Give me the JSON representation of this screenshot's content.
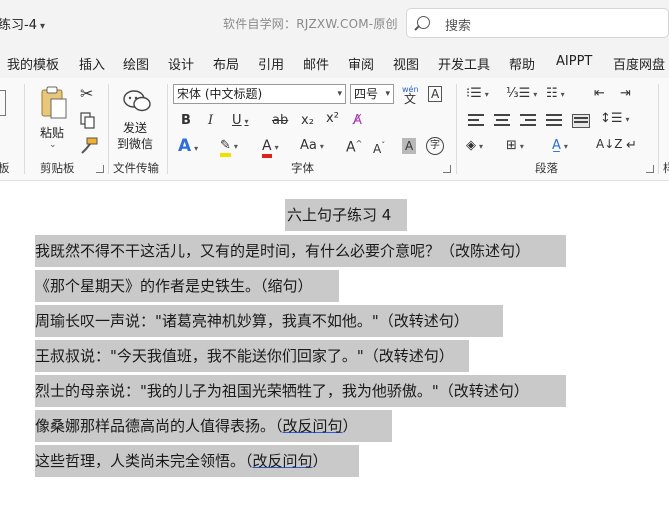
{
  "window": {
    "doc_title": "练习-4",
    "watermark": "软件自学网：RJZXW.COM-原创",
    "search_placeholder": "搜索"
  },
  "menu": [
    "我的模板",
    "插入",
    "绘图",
    "设计",
    "布局",
    "引用",
    "邮件",
    "审阅",
    "视图",
    "开发工具",
    "帮助",
    "AIPPT",
    "百度网盘"
  ],
  "ribbon": {
    "clipboard": {
      "paste_label": "粘贴",
      "group_label": "剪贴板"
    },
    "wechat": {
      "line1": "发送",
      "line2": "到微信",
      "group_label": "文件传输"
    },
    "font": {
      "name": "宋体 (中文标题)",
      "size": "四号",
      "phonetic": "wén",
      "group_label": "字体",
      "bold": "B",
      "italic": "I",
      "underline": "U",
      "strike": "ab",
      "sub": "x₂",
      "sup": "x²",
      "effects": "A",
      "highlight": "ab",
      "color": "A",
      "case": "Aa",
      "grow": "A",
      "shrink": "A",
      "shade": "A",
      "circle": "字"
    },
    "paragraph": {
      "group_label": "段落"
    },
    "partial_label_left": "板",
    "partial_label_right": "样"
  },
  "document": {
    "lines": [
      {
        "text": "六上句子练习 4"
      },
      {
        "text": "我既然不得不干这活儿，又有的是时间，有什么必要介意呢？（改陈述句）"
      },
      {
        "text": "《那个星期天》的作者是史铁生。（缩句）"
      },
      {
        "text": "周瑜长叹一声说：\"诸葛亮神机妙算，我真不如他。\"（改转述句）"
      },
      {
        "text": "王叔叔说：\"今天我值班，我不能送你们回家了。\"（改转述句）"
      },
      {
        "text": "烈士的母亲说：\"我的儿子为祖国光荣牺牲了，我为他骄傲。\"（改转述句）"
      },
      {
        "text": "像桑娜那样品德高尚的人值得表扬。（",
        "link": "改反问句",
        "tail": "）"
      },
      {
        "text": "这些哲理，人类尚未完全领悟。（",
        "link": "改反问句",
        "tail": "）"
      }
    ]
  }
}
